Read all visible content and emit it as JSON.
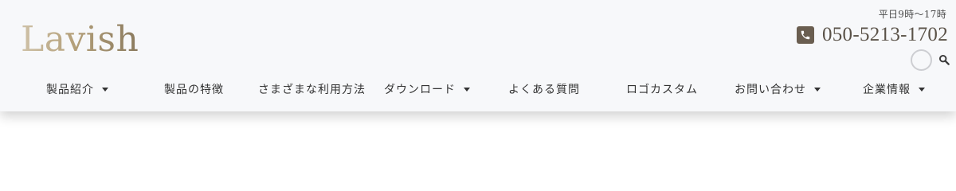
{
  "header": {
    "logo_text": "Lavish",
    "hours": "平日9時～17時",
    "phone_number": "050-5213-1702",
    "accent_color": "#6a5e50",
    "logo_gradient": [
      "#cfc2a8",
      "#b4a07a",
      "#8a7a5e"
    ]
  },
  "nav": {
    "items": [
      {
        "label": "製品紹介",
        "has_dropdown": true
      },
      {
        "label": "製品の特徴",
        "has_dropdown": false
      },
      {
        "label": "さまざまな利用方法",
        "has_dropdown": false
      },
      {
        "label": "ダウンロード",
        "has_dropdown": true
      },
      {
        "label": "よくある質問",
        "has_dropdown": false
      },
      {
        "label": "ロゴカスタム",
        "has_dropdown": false
      },
      {
        "label": "お問い合わせ",
        "has_dropdown": true
      },
      {
        "label": "企業情報",
        "has_dropdown": true
      }
    ]
  },
  "icons": {
    "phone": "phone-icon",
    "search": "search-icon",
    "search_toggle": "search-toggle-circle",
    "dropdown": "caret-down-icon"
  }
}
